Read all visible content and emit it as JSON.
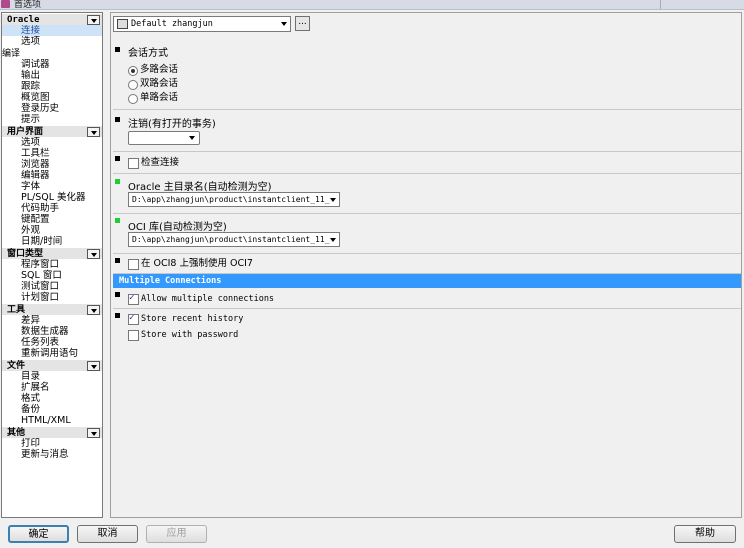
{
  "window": {
    "title": "首选项"
  },
  "sidebar": {
    "categories": [
      {
        "label": "Oracle",
        "items": [
          "连接",
          "选项"
        ]
      },
      {
        "label": "编译",
        "items": [
          "调试器",
          "输出",
          "跟踪",
          "概览图",
          "登录历史",
          "提示"
        ]
      },
      {
        "label": "用户界面",
        "items": [
          "选项",
          "工具栏",
          "浏览器",
          "编辑器",
          "字体",
          "PL/SQL 美化器",
          "代码助手",
          "键配置",
          "外观",
          "日期/时间"
        ]
      },
      {
        "label": "窗口类型",
        "items": [
          "程序窗口",
          "SQL 窗口",
          "测试窗口",
          "计划窗口"
        ]
      },
      {
        "label": "工具",
        "items": [
          "差异",
          "数据生成器",
          "任务列表",
          "重新调用语句"
        ]
      },
      {
        "label": "文件",
        "items": [
          "目录",
          "扩展名",
          "格式",
          "备份",
          "HTML/XML"
        ]
      },
      {
        "label": "其他",
        "items": [
          "打印",
          "更新与消息"
        ]
      }
    ]
  },
  "main": {
    "profile": {
      "value": "Default zhangjun"
    },
    "more_label": "...",
    "session": {
      "title": "会话方式",
      "options": [
        "多路会话",
        "双路会话",
        "单路会话"
      ],
      "selected": 0
    },
    "logoff": {
      "title": "注销(有打开的事务)",
      "value": ""
    },
    "check_connection": {
      "label": "检查连接",
      "checked": false
    },
    "oracle_home": {
      "title": "Oracle 主目录名(自动检测为空)",
      "value": "D:\\app\\zhangjun\\product\\instantclient_11_"
    },
    "oci_library": {
      "title": "OCI 库(自动检测为空)",
      "value": "D:\\app\\zhangjun\\product\\instantclient_11_"
    },
    "force_oci7": {
      "label": "在 OCI8 上强制使用 OCI7",
      "checked": false
    },
    "multiple_connections": {
      "header": "Multiple Connections",
      "allow_label": "Allow multiple connections",
      "allow_checked": true
    },
    "history": {
      "store_recent_label": "Store recent history",
      "store_recent_checked": true,
      "store_password_label": "Store with password",
      "store_password_checked": false
    }
  },
  "buttons": {
    "ok": "确定",
    "cancel": "取消",
    "apply": "应用",
    "help": "帮助"
  },
  "colors": {
    "accent": "#3399ff",
    "marker_green": "#22cc33",
    "selection": "#cfe3f7"
  }
}
